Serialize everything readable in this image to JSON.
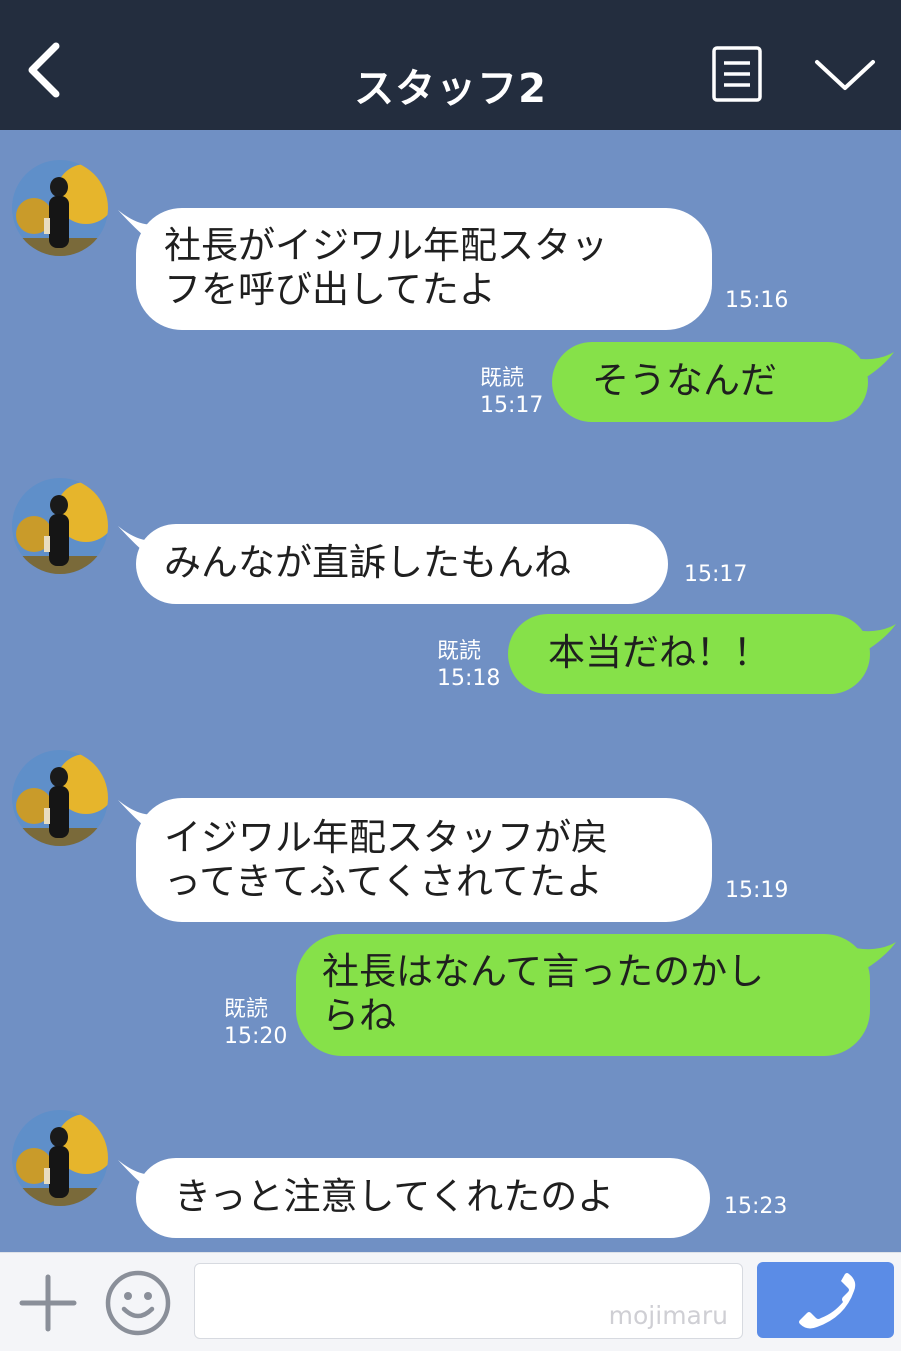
{
  "header": {
    "title": "スタッフ2"
  },
  "messages": [
    {
      "side": "in",
      "lines": [
        "社長がイジワル年配スタッ",
        "フを呼び出してたよ"
      ],
      "time": "15:16"
    },
    {
      "side": "out",
      "lines": [
        "そうなんだ"
      ],
      "read": "既読",
      "time": "15:17"
    },
    {
      "side": "in",
      "lines": [
        "みんなが直訴したもんね"
      ],
      "time": "15:17"
    },
    {
      "side": "out",
      "lines": [
        "本当だね！！"
      ],
      "read": "既読",
      "time": "15:18"
    },
    {
      "side": "in",
      "lines": [
        "イジワル年配スタッフが戻",
        "ってきてふてくされてたよ"
      ],
      "time": "15:19"
    },
    {
      "side": "out",
      "lines": [
        "社長はなんて言ったのかし",
        "らね"
      ],
      "read": "既読",
      "time": "15:20"
    },
    {
      "side": "in",
      "lines": [
        "きっと注意してくれたのよ"
      ],
      "time": "15:23"
    }
  ],
  "input": {
    "value": "",
    "watermark": "mojimaru"
  },
  "icons": {
    "back": "back-chevron-icon",
    "menu": "menu-list-icon",
    "collapse": "chevron-down-icon",
    "add": "plus-icon",
    "sticker": "smiley-icon",
    "send": "phone-icon"
  },
  "colors": {
    "header": "#232d3e",
    "chat_background": "#7090c4",
    "incoming_bubble": "#ffffff",
    "outgoing_bubble": "#86e149",
    "send_button": "#5b8ce6"
  }
}
